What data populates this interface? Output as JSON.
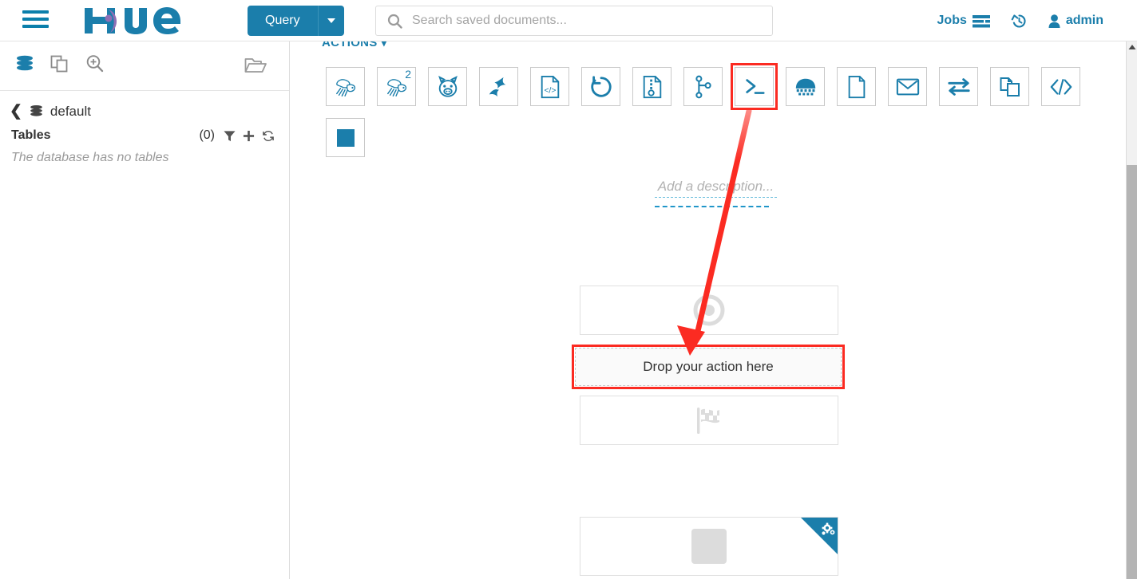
{
  "colors": {
    "brand_blue": "#1b7eab",
    "logo_purple": "#8e6fb5",
    "highlight_red": "#fb2b22",
    "muted_gray": "#9a9a9a"
  },
  "topnav": {
    "menu_icon": "hamburger-icon",
    "logo_text": "hue",
    "query_button": {
      "label": "Query",
      "caret_icon": "chevron-down-icon"
    },
    "search": {
      "placeholder": "Search saved documents...",
      "value": "",
      "icon": "search-icon"
    },
    "right_items": [
      {
        "label": "Jobs",
        "icon": "jobs-list-icon"
      },
      {
        "label": "",
        "icon": "history-icon"
      },
      {
        "label": "admin",
        "icon": "user-icon"
      }
    ]
  },
  "sidebar": {
    "assist_tabs": [
      {
        "name": "sources",
        "icon": "database-icon",
        "active": true
      },
      {
        "name": "documents",
        "icon": "documents-icon",
        "active": false
      },
      {
        "name": "search",
        "icon": "magnifier-plus-icon",
        "active": false
      }
    ],
    "open_folder_icon": "open-folder-icon",
    "breadcrumb": {
      "back_icon": "chevron-left-icon",
      "db_icon": "database-icon",
      "database": "default"
    },
    "tables": {
      "label": "Tables",
      "count": "(0)",
      "tools": [
        {
          "name": "filter",
          "icon": "filter-icon"
        },
        {
          "name": "add",
          "icon": "plus-icon"
        },
        {
          "name": "refresh",
          "icon": "refresh-icon"
        }
      ],
      "empty_message": "The database has no tables"
    }
  },
  "main": {
    "actions_header": {
      "label": "ACTIONS",
      "caret_icon": "caret-down-icon"
    },
    "action_tiles": [
      {
        "name": "hive",
        "icon": "hive-bee-icon",
        "badge": ""
      },
      {
        "name": "hive2",
        "icon": "hive-bee-icon",
        "badge": "2"
      },
      {
        "name": "pig",
        "icon": "pig-icon",
        "badge": ""
      },
      {
        "name": "spark",
        "icon": "spark-star-icon",
        "badge": ""
      },
      {
        "name": "java",
        "icon": "code-document-icon",
        "badge": ""
      },
      {
        "name": "sqoop",
        "icon": "circle-arrow-icon",
        "badge": ""
      },
      {
        "name": "mapreduce",
        "icon": "archive-document-icon",
        "badge": ""
      },
      {
        "name": "subworkflow",
        "icon": "branch-icon",
        "badge": ""
      },
      {
        "name": "shell",
        "icon": "terminal-prompt-icon",
        "badge": "",
        "highlighted": true
      },
      {
        "name": "distcp",
        "icon": "hadoop-elephant-icon",
        "badge": ""
      },
      {
        "name": "fs",
        "icon": "file-icon",
        "badge": ""
      },
      {
        "name": "email",
        "icon": "envelope-icon",
        "badge": ""
      },
      {
        "name": "streaming",
        "icon": "transfer-arrows-icon",
        "badge": ""
      },
      {
        "name": "copy",
        "icon": "copy-files-icon",
        "badge": ""
      },
      {
        "name": "generic",
        "icon": "code-brackets-icon",
        "badge": ""
      },
      {
        "name": "kill",
        "icon": "stop-square-icon",
        "badge": ""
      }
    ],
    "workflow": {
      "description_placeholder": "Add a description...",
      "nodes": [
        {
          "name": "start-node",
          "icon": "target-bullseye-icon"
        },
        {
          "name": "end-node",
          "icon": "checkered-flag-icon"
        },
        {
          "name": "kill-node",
          "icon": "gray-square-icon",
          "corner_icon": "gears-icon"
        }
      ],
      "dropzone_label": "Drop your action here"
    },
    "annotation": {
      "arrow_color": "#fb2b22",
      "from": "shell-action-tile",
      "to": "dropzone"
    }
  },
  "scrollbar": {
    "up_arrow_icon": "caret-up-icon"
  }
}
